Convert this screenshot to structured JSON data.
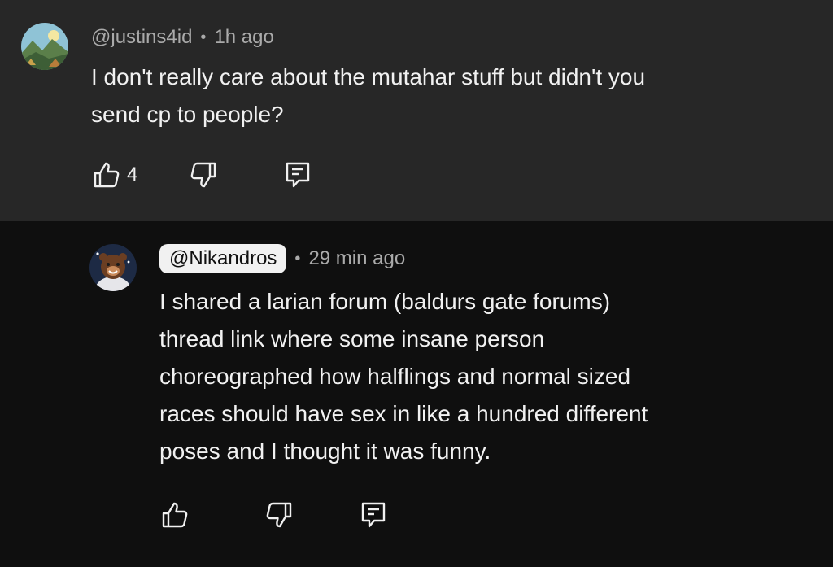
{
  "comments": [
    {
      "author": "@justins4id",
      "time": "1h ago",
      "text_lines": [
        "I don't really care about the mutahar stuff but didn't you",
        "send cp to people?"
      ],
      "like_count": "4",
      "separator": "•"
    }
  ],
  "reply": {
    "author": "@Nikandros",
    "time": "29 min ago",
    "separator": "•",
    "text_lines": [
      "I shared a larian forum (baldurs gate forums)",
      "thread link where some insane person",
      "choreographed how halflings and normal sized",
      "races should have sex in like a hundred different",
      "poses and I thought it was funny."
    ]
  },
  "icons": {
    "like": "thumbs-up-icon",
    "dislike": "thumbs-down-icon",
    "reply": "comment-icon"
  },
  "colors": {
    "top_background": "#272727",
    "reply_background": "#0f0f0f",
    "secondary_text": "#aaaaaa",
    "primary_text": "#f1f1f1"
  }
}
